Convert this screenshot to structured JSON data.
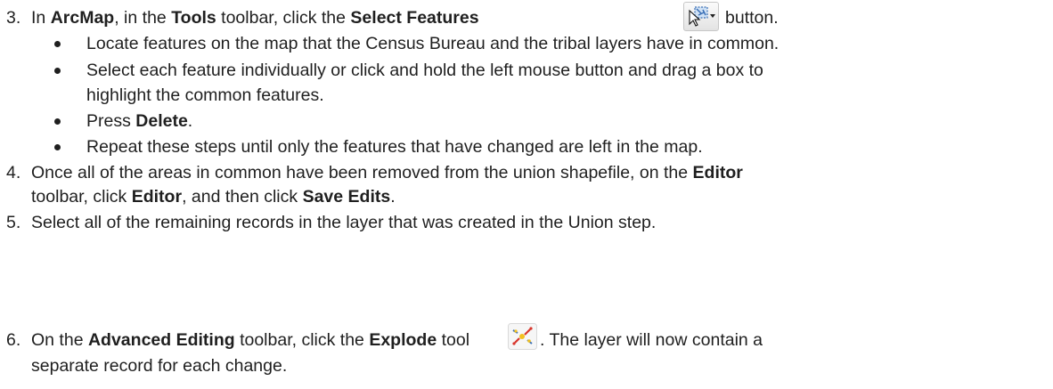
{
  "steps": [
    {
      "num": "3.",
      "parts": [
        {
          "t": "In ",
          "b": false
        },
        {
          "t": "ArcMap",
          "b": true
        },
        {
          "t": ", in the ",
          "b": false
        },
        {
          "t": "Tools",
          "b": true
        },
        {
          "t": " toolbar, click the ",
          "b": false
        },
        {
          "t": "Select Features",
          "b": true
        }
      ],
      "after_icon": "button.",
      "icon": "select-features-icon",
      "bullets": [
        {
          "text": "Locate features on the map that the Census Bureau and the tribal layers have in common."
        },
        {
          "text": "Select each feature individually or click and hold the left mouse button and drag a box to",
          "text2": "highlight the common features."
        },
        {
          "pre": "Press ",
          "bold": "Delete",
          "post": "."
        },
        {
          "text": "Repeat these steps until only the features that have changed are left in the map."
        }
      ]
    },
    {
      "num": "4.",
      "l1": {
        "pre": "Once all of the areas in common have been removed from the union shapefile, on the ",
        "bold": "Editor"
      },
      "l2": {
        "pre": "toolbar, click ",
        "b1": "Editor",
        "mid": ", and then click ",
        "b2": "Save Edits",
        "post": "."
      }
    },
    {
      "num": "5.",
      "text": "Select all of the remaining records in the layer that was created in the Union step."
    },
    {
      "num": "6.",
      "l1": {
        "pre": "On the ",
        "b1": "Advanced Editing",
        "mid": " toolbar, click the ",
        "b2": "Explode",
        "post": " tool",
        "post2": ". The layer will now contain a"
      },
      "l2": "separate record for each change.",
      "icon": "explode-icon"
    }
  ],
  "colors": {
    "text": "#1f1f1f",
    "icon_blue": "#3a6fb5",
    "icon_yellow": "#f2c01e",
    "icon_red": "#d8342b"
  }
}
